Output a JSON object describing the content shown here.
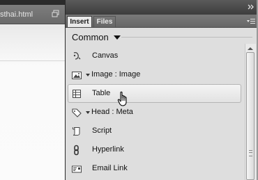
{
  "document": {
    "tab_label": "sthai.html",
    "restore_icon": "window-restore-icon"
  },
  "panel": {
    "collapse_icon": "double-chevron-right-icon",
    "menu_icon": "panel-menu-icon",
    "tabs": [
      {
        "label": "Insert",
        "active": true
      },
      {
        "label": "Files",
        "active": false
      }
    ],
    "category": {
      "label": "Common",
      "icon": "dropdown-arrow-icon"
    },
    "items": [
      {
        "label": "Canvas",
        "icon": "canvas-icon",
        "has_dropdown": false,
        "selected": false
      },
      {
        "label": "Image : Image",
        "icon": "image-icon",
        "has_dropdown": true,
        "selected": false
      },
      {
        "label": "Table",
        "icon": "table-icon",
        "has_dropdown": false,
        "selected": true
      },
      {
        "label": "Head : Meta",
        "icon": "tag-icon",
        "has_dropdown": true,
        "selected": false
      },
      {
        "label": "Script",
        "icon": "script-icon",
        "has_dropdown": false,
        "selected": false
      },
      {
        "label": "Hyperlink",
        "icon": "hyperlink-icon",
        "has_dropdown": false,
        "selected": false
      },
      {
        "label": "Email Link",
        "icon": "email-link-icon",
        "has_dropdown": false,
        "selected": false
      }
    ]
  },
  "cursor": {
    "icon": "hand-pointer-icon"
  }
}
